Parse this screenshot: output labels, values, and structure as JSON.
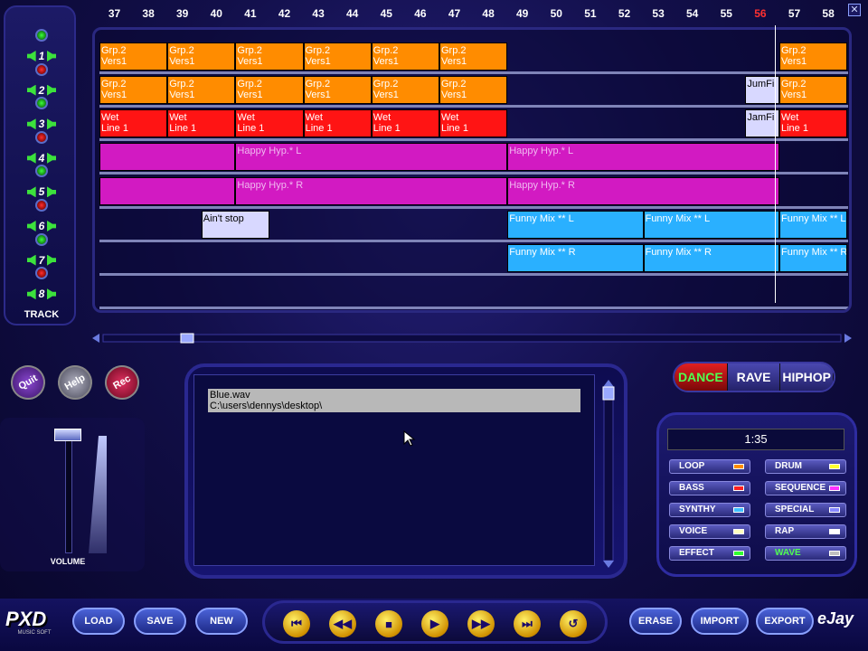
{
  "window": {
    "close_label": "✕"
  },
  "ruler": {
    "bars": [
      "37",
      "38",
      "39",
      "40",
      "41",
      "42",
      "43",
      "44",
      "45",
      "46",
      "47",
      "48",
      "49",
      "50",
      "51",
      "52",
      "53",
      "54",
      "55",
      "56",
      "57",
      "58"
    ],
    "highlight_bar": "56"
  },
  "tracks": {
    "numbers": [
      "1",
      "2",
      "3",
      "4",
      "5",
      "6",
      "7",
      "8"
    ],
    "label": "TRACK"
  },
  "lanes": [
    {
      "samples": [
        {
          "text": "Grp.2\nVers1",
          "color": "orange"
        },
        {
          "text": "Grp.2\nVers1",
          "color": "orange"
        },
        {
          "text": "Grp.2\nVers1",
          "color": "orange"
        },
        {
          "text": "Grp.2\nVers1",
          "color": "orange"
        },
        {
          "text": "Grp.2\nVers1",
          "color": "orange"
        },
        {
          "text": "Grp.2\nVers1",
          "color": "orange"
        },
        {
          "text": "Grp.2\nVers1",
          "color": "orange"
        }
      ]
    },
    {
      "samples": [
        {
          "text": "Grp.2\nVers1",
          "color": "orange"
        },
        {
          "text": "Grp.2\nVers1",
          "color": "orange"
        },
        {
          "text": "Grp.2\nVers1",
          "color": "orange"
        },
        {
          "text": "Grp.2\nVers1",
          "color": "orange"
        },
        {
          "text": "Grp.2\nVers1",
          "color": "orange"
        },
        {
          "text": "Grp.2\nVers1",
          "color": "orange"
        },
        {
          "text": "JumFi",
          "color": "lavender"
        },
        {
          "text": "Grp.2\nVers1",
          "color": "orange"
        }
      ]
    },
    {
      "samples": [
        {
          "text": "Wet\nLine 1",
          "color": "red"
        },
        {
          "text": "Wet\nLine 1",
          "color": "red"
        },
        {
          "text": "Wet\nLine 1",
          "color": "red"
        },
        {
          "text": "Wet\nLine 1",
          "color": "red"
        },
        {
          "text": "Wet\nLine 1",
          "color": "red"
        },
        {
          "text": "Wet\nLine 1",
          "color": "red"
        },
        {
          "text": "JamFi",
          "color": "lavender"
        },
        {
          "text": "Wet\nLine 1",
          "color": "red"
        }
      ]
    },
    {
      "samples": [
        {
          "text": "",
          "color": "magenta"
        },
        {
          "text": "Happy Hyp.* L",
          "color": "magenta"
        },
        {
          "text": "Happy Hyp.* L",
          "color": "magenta"
        }
      ]
    },
    {
      "samples": [
        {
          "text": "",
          "color": "magenta"
        },
        {
          "text": "Happy Hyp.* R",
          "color": "magenta"
        },
        {
          "text": "Happy Hyp.* R",
          "color": "magenta"
        }
      ]
    },
    {
      "samples": [
        {
          "text": "Ain't stop",
          "color": "lavender"
        },
        {
          "text": "Funny Mix ** L",
          "color": "cyan"
        },
        {
          "text": "Funny Mix ** L",
          "color": "cyan"
        },
        {
          "text": "Funny Mix ** L",
          "color": "cyan"
        }
      ]
    },
    {
      "samples": [
        {
          "text": "Funny Mix ** R",
          "color": "cyan"
        },
        {
          "text": "Funny Mix ** R",
          "color": "cyan"
        },
        {
          "text": "Funny Mix ** R",
          "color": "cyan"
        }
      ]
    },
    {
      "samples": []
    }
  ],
  "round_buttons": {
    "quit": "Quit",
    "help": "Help",
    "rec": "Rec"
  },
  "volume": {
    "label": "VOLUME",
    "level": 1.0
  },
  "browser": {
    "selected_name": "Blue.wav",
    "selected_path": "C:\\users\\dennys\\desktop\\"
  },
  "styles": {
    "dance": "DANCE",
    "rave": "RAVE",
    "hiphop": "HIPHOP",
    "active": "DANCE"
  },
  "timer": "1:35",
  "categories": [
    {
      "label": "LOOP",
      "color": "#ff8c00"
    },
    {
      "label": "DRUM",
      "color": "#ffff30"
    },
    {
      "label": "BASS",
      "color": "#ff2020"
    },
    {
      "label": "SEQUENCE",
      "color": "#ff30ff"
    },
    {
      "label": "SYNTHY",
      "color": "#40c0ff"
    },
    {
      "label": "SPECIAL",
      "color": "#8888ff"
    },
    {
      "label": "VOICE",
      "color": "#ffffc0"
    },
    {
      "label": "RAP",
      "color": "#ffffff"
    },
    {
      "label": "EFFECT",
      "color": "#30ff30"
    },
    {
      "label": "WAVE",
      "color": "#c0c0c0"
    }
  ],
  "bottom": {
    "load": "LOAD",
    "save": "SAVE",
    "new": "NEW",
    "erase": "ERASE",
    "import": "IMPORT",
    "export": "EXPORT",
    "logo_left": "PXD",
    "logo_left_sub": "MUSIC SOFT",
    "logo_right": "eJay"
  },
  "transport": [
    "⏮",
    "◀◀",
    "■",
    "▶",
    "▶▶",
    "⏭",
    "↺"
  ],
  "colors": {
    "orange": "#ff8c00",
    "red": "#ff1414",
    "magenta": "#d21ac2",
    "cyan": "#2ab0ff",
    "lavender": "#d8d8ff"
  }
}
